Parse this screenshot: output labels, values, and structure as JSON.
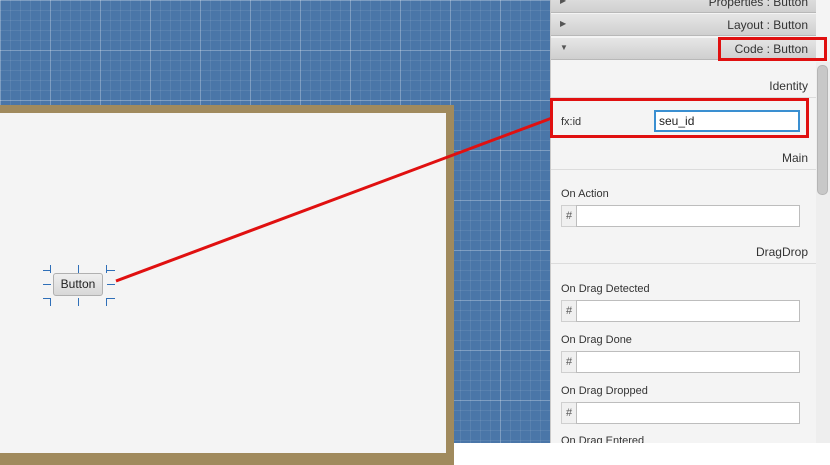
{
  "canvas": {
    "button_label": "Button"
  },
  "inspector": {
    "headers": [
      {
        "label": "Properties : Button",
        "arrow": "▶",
        "expanded": false
      },
      {
        "label": "Layout : Button",
        "arrow": "▶",
        "expanded": false
      },
      {
        "label": "Code : Button",
        "arrow": "▼",
        "expanded": true
      }
    ],
    "sections": {
      "identity": "Identity",
      "main": "Main",
      "dragdrop": "DragDrop"
    },
    "fxid": {
      "label": "fx:id",
      "value": "seu_id"
    },
    "handler_prefix": "#",
    "handlers": [
      {
        "label": "On Action",
        "value": ""
      },
      {
        "label": "On Drag Detected",
        "value": ""
      },
      {
        "label": "On Drag Done",
        "value": ""
      },
      {
        "label": "On Drag Dropped",
        "value": ""
      },
      {
        "label": "On Drag Entered",
        "value": ""
      }
    ]
  },
  "colors": {
    "annotation": "#e01010",
    "canvas_bg": "#4a76a8",
    "selection_handle": "#2f6fb8"
  }
}
